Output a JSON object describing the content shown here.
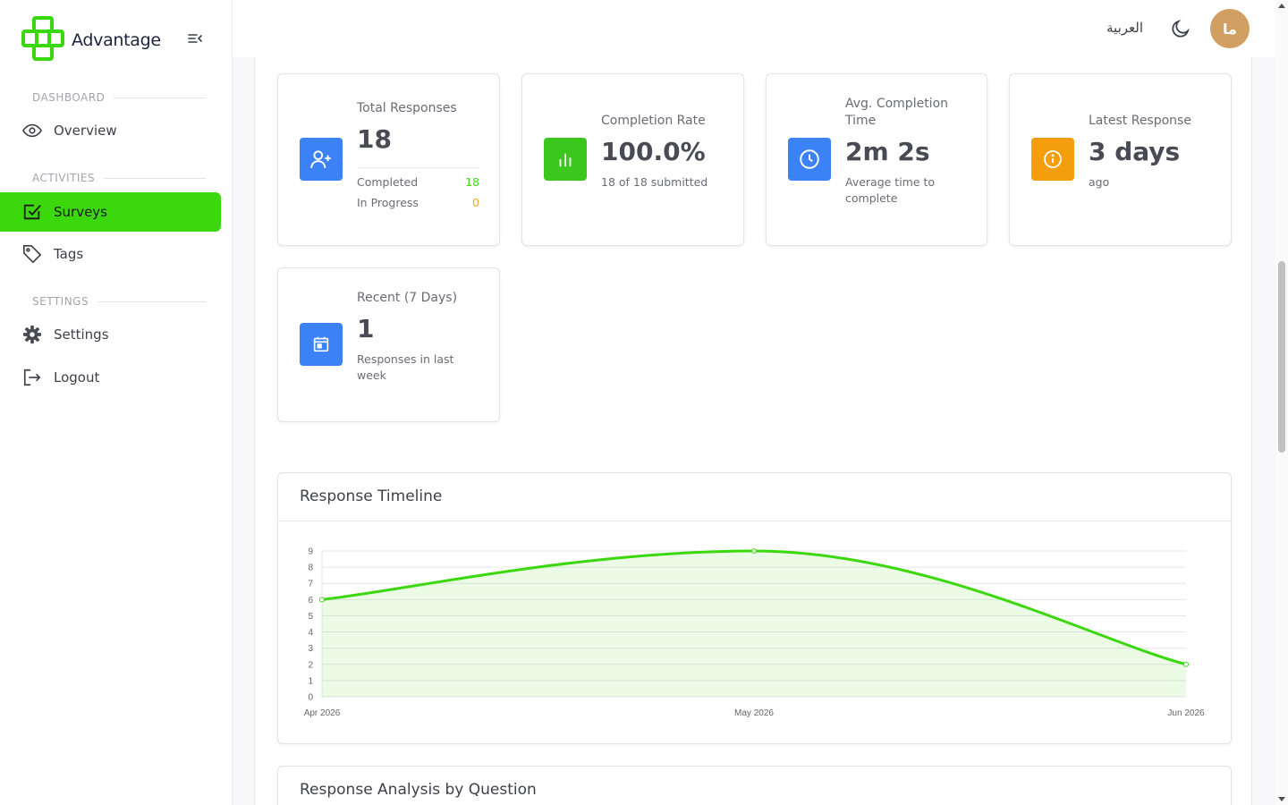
{
  "brand": {
    "name": "Advantage"
  },
  "colors": {
    "accent": "#3bd80e",
    "blue": "#3b82f6",
    "orange": "#f59e0b",
    "avatar": "#d29f63"
  },
  "sidebar": {
    "sections": [
      {
        "label": "DASHBOARD"
      },
      {
        "label": "ACTIVITIES"
      },
      {
        "label": "SETTINGS"
      }
    ],
    "items": [
      {
        "label": "Overview",
        "icon": "eye-icon"
      },
      {
        "label": "Surveys",
        "icon": "checkbox-icon",
        "active": true
      },
      {
        "label": "Tags",
        "icon": "tag-icon"
      },
      {
        "label": "Settings",
        "icon": "gear-icon"
      },
      {
        "label": "Logout",
        "icon": "logout-icon"
      }
    ]
  },
  "header": {
    "language": "العربية",
    "avatar_initials": "ما"
  },
  "stats": {
    "total": {
      "title": "Total Responses",
      "value": "18",
      "completed_label": "Completed",
      "completed_value": "18",
      "progress_label": "In Progress",
      "progress_value": "0"
    },
    "completion": {
      "title": "Completion Rate",
      "value": "100.0%",
      "sub": "18 of 18 submitted"
    },
    "avg_time": {
      "title": "Avg. Completion Time",
      "value": "2m 2s",
      "sub": "Average time to complete"
    },
    "latest": {
      "title": "Latest Response",
      "value": "3 days",
      "sub": "ago"
    },
    "recent": {
      "title": "Recent (7 Days)",
      "value": "1",
      "sub": "Responses in last week"
    }
  },
  "timeline": {
    "title": "Response Timeline"
  },
  "analysis": {
    "title": "Response Analysis by Question"
  },
  "chart_data": {
    "type": "area",
    "categories": [
      "Apr 2026",
      "May 2026",
      "Jun 2026"
    ],
    "series": [
      {
        "values": [
          6,
          9,
          2
        ]
      }
    ],
    "title": "Response Timeline",
    "xlabel": "",
    "ylabel": "",
    "ylim": [
      0,
      9
    ],
    "yticks": [
      0,
      1,
      2,
      3,
      4,
      5,
      6,
      7,
      8,
      9
    ],
    "grid": true,
    "color": "#3bd80e"
  }
}
